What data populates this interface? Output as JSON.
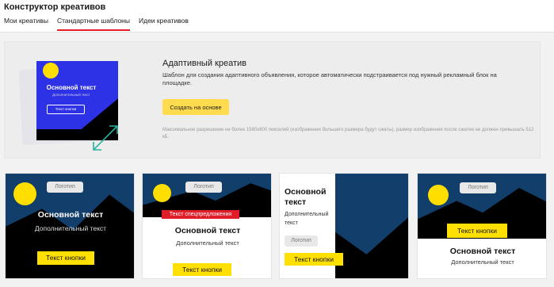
{
  "app": {
    "title": "Конструктор креативов"
  },
  "tabs": [
    {
      "label": "Мои креативы",
      "active": false
    },
    {
      "label": "Стандартные шаблоны",
      "active": true
    },
    {
      "label": "Идеи креативов",
      "active": false
    }
  ],
  "hero": {
    "title": "Адаптивный креатив",
    "description": "Шаблон для создания адаптивного объявления, которое автоматически подстраивается под нужный рекламный блок на площадке.",
    "button_label": "Создать на основе",
    "note": "Максимальное разрешение не более 1580х800 пикселей (изображения большего размера будут сжаты), размер изображения после сжатия не должен превышать 512 кБ.",
    "preview": {
      "main_text": "Основной текст",
      "sub_text": "Дополнительный текст",
      "button_text": "Текст кнопки"
    }
  },
  "templates": [
    {
      "logo": "Логотип",
      "main_text": "Основной текст",
      "sub_text": "Дополнительный текст",
      "button_text": "Текст кнопки"
    },
    {
      "logo": "Логотип",
      "ribbon": "Текст спецпредложения",
      "main_text": "Основной текст",
      "sub_text": "Дополнительный текст",
      "button_text": "Текст кнопки"
    },
    {
      "logo": "Логотип",
      "main_text": "Основной текст",
      "sub_text": "Дополнительный текст",
      "button_text": "Текст кнопки"
    },
    {
      "logo": "Логотип",
      "main_text": "Основной текст",
      "sub_text": "Дополнительный текст",
      "button_text": "Текст кнопки"
    }
  ],
  "colors": {
    "accent_yellow": "#ffe000",
    "navy": "#123e6b",
    "tab_underline": "#e21f26",
    "ribbon_red": "#e11d2a",
    "preview_blue": "#2d32e6"
  }
}
